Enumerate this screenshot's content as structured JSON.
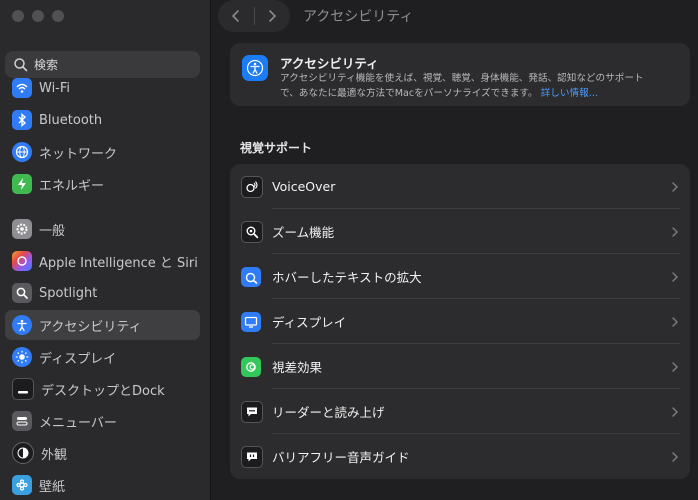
{
  "window": {
    "title": "アクセシビリティ"
  },
  "search": {
    "placeholder": "検索"
  },
  "sidebar": {
    "items": [
      {
        "label": "Wi-Fi",
        "icon": "wifi-icon",
        "color": "#2f7cf6"
      },
      {
        "label": "Bluetooth",
        "icon": "bluetooth-icon",
        "color": "#2f7cf6"
      },
      {
        "label": "ネットワーク",
        "icon": "globe-icon",
        "color": "#2f7cf6"
      },
      {
        "label": "エネルギー",
        "icon": "battery-icon",
        "color": "#3fb950"
      },
      {
        "label": "一般",
        "icon": "gear-icon",
        "color": "#8e8e93"
      },
      {
        "label": "Apple Intelligence と Siri",
        "icon": "siri-icon",
        "color": "#e8714a"
      },
      {
        "label": "Spotlight",
        "icon": "spotlight-icon",
        "color": "#5a5a5e"
      },
      {
        "label": "アクセシビリティ",
        "icon": "accessibility-icon",
        "color": "#2f7cf6"
      },
      {
        "label": "ディスプレイ",
        "icon": "sun-icon",
        "color": "#2f7cf6"
      },
      {
        "label": "デスクトップとDock",
        "icon": "dock-icon",
        "color": "#1c1c1e"
      },
      {
        "label": "メニューバー",
        "icon": "menubar-icon",
        "color": "#5a5a5e"
      },
      {
        "label": "外観",
        "icon": "appearance-icon",
        "color": "#1c1c1e"
      },
      {
        "label": "壁紙",
        "icon": "wallpaper-icon",
        "color": "#3aa0e0"
      }
    ]
  },
  "info": {
    "title": "アクセシビリティ",
    "desc_line1": "アクセシビリティ機能を使えば、視覚、聴覚、身体機能、発話、認知などのサポート",
    "desc_line2": "で、あなたに最適な方法でMacをパーソナライズできます。",
    "link": "詳しい情報…"
  },
  "section": {
    "title": "視覚サポート"
  },
  "vision": {
    "items": [
      {
        "label": "VoiceOver",
        "icon": "voiceover-icon"
      },
      {
        "label": "ズーム機能",
        "icon": "zoom-icon"
      },
      {
        "label": "ホバーしたテキストの拡大",
        "icon": "hover-text-icon"
      },
      {
        "label": "ディスプレイ",
        "icon": "display-icon"
      },
      {
        "label": "視差効果",
        "icon": "motion-icon"
      },
      {
        "label": "リーダーと読み上げ",
        "icon": "spoken-content-icon"
      },
      {
        "label": "バリアフリー音声ガイド",
        "icon": "audio-descriptions-icon"
      }
    ]
  }
}
